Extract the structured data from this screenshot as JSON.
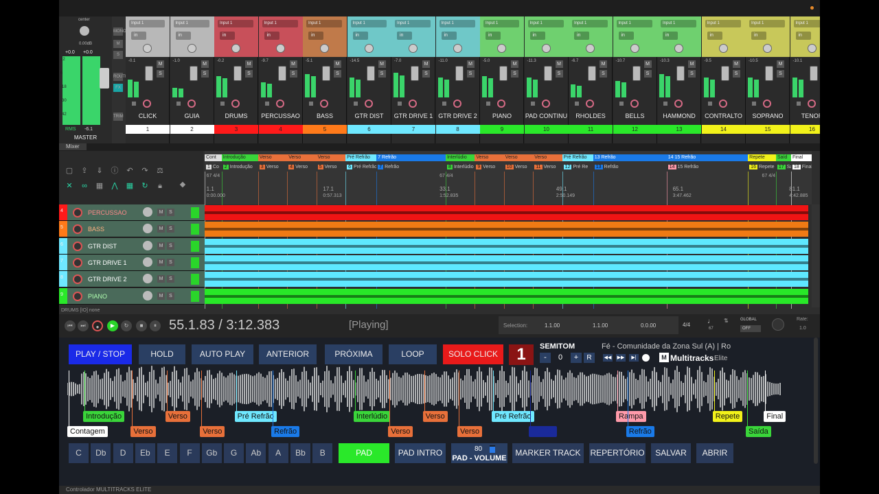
{
  "mixer": {
    "tab": "Mixer",
    "master": {
      "pan": "center",
      "vol_db": "0.00dB",
      "peak_l": "+0.0",
      "peak_r": "+0.0",
      "rms_label": "RMS",
      "rms_value": "-6.1",
      "name": "MASTER",
      "scale": [
        "12",
        "6",
        "-18",
        "-30",
        "-42"
      ],
      "side_buttons": [
        "MONO",
        "M",
        "S",
        "ROUTE",
        "FX",
        "TRIM"
      ],
      "side_button_colors": [
        "#555",
        "#555",
        "#555",
        "#555",
        "#1aa5a5",
        "#555"
      ]
    },
    "strips": [
      {
        "name": "CLICK",
        "num": "1",
        "color": "#b8b8b8",
        "numcolor": "#ffffff",
        "vol": "-0.1",
        "in": "in",
        "input": "Input 1",
        "meter": 0.55
      },
      {
        "name": "GUIA",
        "num": "2",
        "color": "#b8b8b8",
        "numcolor": "#ffffff",
        "vol": "-1.0",
        "in": "in",
        "input": "Input 1",
        "meter": 0.3
      },
      {
        "name": "DRUMS",
        "num": "3",
        "color": "#c8505a",
        "numcolor": "#ff1a1a",
        "vol": "-0.2",
        "in": "in",
        "input": "Input 1",
        "meter": 0.65
      },
      {
        "name": "PERCUSSAO",
        "num": "4",
        "color": "#c8505a",
        "numcolor": "#ff1a1a",
        "vol": "-9.7",
        "in": "in",
        "input": "Input 1",
        "meter": 0.45
      },
      {
        "name": "BASS",
        "num": "5",
        "color": "#c07a4a",
        "numcolor": "#ff7a1a",
        "vol": "-5.1",
        "in": "in",
        "input": "Input 1",
        "meter": 0.7
      },
      {
        "name": "GTR DIST",
        "num": "6",
        "color": "#6fc8c8",
        "numcolor": "#6fe8ff",
        "vol": "-14.5",
        "in": "in",
        "input": "Input 1",
        "meter": 0.6
      },
      {
        "name": "GTR DRIVE 1",
        "num": "7",
        "color": "#6fc8c8",
        "numcolor": "#6fe8ff",
        "vol": "-7.0",
        "in": "in",
        "input": "Input 1",
        "meter": 0.75
      },
      {
        "name": "GTR DRIVE 2",
        "num": "8",
        "color": "#6fc8c8",
        "numcolor": "#6fe8ff",
        "vol": "-11.0",
        "in": "in",
        "input": "Input 1",
        "meter": 0.6
      },
      {
        "name": "PIANO",
        "num": "9",
        "color": "#6fd06f",
        "numcolor": "#2ae82a",
        "vol": "-5.0",
        "in": "in",
        "input": "Input 1",
        "meter": 0.65
      },
      {
        "name": "PAD CONTINU",
        "num": "10",
        "color": "#6fd06f",
        "numcolor": "#2ae82a",
        "vol": "-11.3",
        "in": "in",
        "input": "Input 1",
        "meter": 0.6
      },
      {
        "name": "RHOLDES",
        "num": "11",
        "color": "#6fd06f",
        "numcolor": "#2ae82a",
        "vol": "-6.7",
        "in": "in",
        "input": "Input 1",
        "meter": 0.4
      },
      {
        "name": "BELLS",
        "num": "12",
        "color": "#6fd06f",
        "numcolor": "#2ae82a",
        "vol": "-10.7",
        "in": "in",
        "input": "Input 1",
        "meter": 0.5
      },
      {
        "name": "HAMMOND",
        "num": "13",
        "color": "#6fd06f",
        "numcolor": "#2ae82a",
        "vol": "-10.3",
        "in": "in",
        "input": "Input 1",
        "meter": 0.7
      },
      {
        "name": "CONTRALTO",
        "num": "14",
        "color": "#c8c85a",
        "numcolor": "#f2f21a",
        "vol": "-9.5",
        "in": "in",
        "input": "Input 1",
        "meter": 0.6
      },
      {
        "name": "SOPRANO",
        "num": "15",
        "color": "#c8c85a",
        "numcolor": "#f2f21a",
        "vol": "-10.5",
        "in": "in",
        "input": "Input 1",
        "meter": 0.6
      },
      {
        "name": "TENOR",
        "num": "16",
        "color": "#c8c85a",
        "numcolor": "#f2f21a",
        "vol": "-10.1",
        "in": "in",
        "input": "Input 1",
        "meter": 0.6
      }
    ]
  },
  "arrange": {
    "regions": [
      {
        "label": "Cont",
        "color": "#dddddd"
      },
      {
        "label": "Introdução",
        "color": "#3ad53a"
      },
      {
        "label": "Verso",
        "color": "#e8703a"
      },
      {
        "label": "Verso",
        "color": "#e8703a"
      },
      {
        "label": "Verso",
        "color": "#e8703a"
      },
      {
        "label": "Pré Refrão",
        "color": "#6fe8ff"
      },
      {
        "label": "7  Refrão",
        "color": "#1a7ae8"
      },
      {
        "label": "Interlúdio",
        "color": "#3ad53a"
      },
      {
        "label": "Verso",
        "color": "#e8703a"
      },
      {
        "label": "Verso",
        "color": "#e8703a"
      },
      {
        "label": "Verso",
        "color": "#e8703a"
      },
      {
        "label": "Pré Refrão",
        "color": "#6fe8ff"
      },
      {
        "label": "13  Refrão",
        "color": "#1a7ae8"
      },
      {
        "label": "14  15  Refrão",
        "color": "#1a7ae8"
      },
      {
        "label": "Repete",
        "color": "#f2f21a"
      },
      {
        "label": "Saíd",
        "color": "#3ad53a"
      },
      {
        "label": "Final",
        "color": "#ffffff"
      }
    ],
    "region_pos": [
      0,
      0.028,
      0.088,
      0.136,
      0.184,
      0.232,
      0.283,
      0.397,
      0.445,
      0.493,
      0.541,
      0.589,
      0.64,
      0.761,
      0.895,
      0.941,
      0.966
    ],
    "markers": [
      {
        "num": "1",
        "label": "Co",
        "color": "#dddddd"
      },
      {
        "num": "2",
        "label": "Introdução",
        "color": "#3ad53a"
      },
      {
        "num": "3",
        "label": "Verso",
        "color": "#e8703a"
      },
      {
        "num": "4",
        "label": "Verso",
        "color": "#e8703a"
      },
      {
        "num": "5",
        "label": "Verso",
        "color": "#e8703a"
      },
      {
        "num": "6",
        "label": "Pré Refrão",
        "color": "#6fe8ff"
      },
      {
        "num": "7",
        "label": "Refrão",
        "color": "#1a7ae8"
      },
      {
        "num": "8",
        "label": "Interlúdio",
        "color": "#3ad53a"
      },
      {
        "num": "9",
        "label": "Verso",
        "color": "#e8703a"
      },
      {
        "num": "10",
        "label": "Verso",
        "color": "#e8703a"
      },
      {
        "num": "11",
        "label": "Verso",
        "color": "#e8703a"
      },
      {
        "num": "12",
        "label": "Pré Re",
        "color": "#6fe8ff"
      },
      {
        "num": "13",
        "label": "Refrão",
        "color": "#1a7ae8"
      },
      {
        "num": "14",
        "label": "15 Refrão",
        "color": "#ff9aaa"
      },
      {
        "num": "16",
        "label": "Repete",
        "color": "#f2f21a"
      },
      {
        "num": "17",
        "label": "Saída",
        "color": "#3ad53a"
      },
      {
        "num": "18",
        "label": "Final",
        "color": "#ffffff"
      }
    ],
    "ticks": [
      {
        "bar": "1.1",
        "time": "0:00.000",
        "pos": 0.003
      },
      {
        "bar": "17.1",
        "time": "0:57.313",
        "pos": 0.195
      },
      {
        "bar": "33.1",
        "time": "1:52.835",
        "pos": 0.387
      },
      {
        "bar": "49.1",
        "time": "2:50.149",
        "pos": 0.579
      },
      {
        "bar": "65.1",
        "time": "3:47.462",
        "pos": 0.771
      },
      {
        "bar": "81.1",
        "time": "4:42.885",
        "pos": 0.963
      }
    ],
    "tempo_marks": [
      {
        "label": "67 4/4",
        "pos": 0.003
      },
      {
        "label": "67 4/4",
        "pos": 0.387
      },
      {
        "label": "67 4/4",
        "pos": 0.918
      }
    ],
    "tracks": [
      {
        "num": "4",
        "name": "PERCUSSAO",
        "color": "#ff1a1a",
        "lane": "#f01414",
        "text": "#ff8a8a"
      },
      {
        "num": "5",
        "name": "BASS",
        "color": "#ff7a1a",
        "lane": "#f07a14",
        "text": "#ffb080"
      },
      {
        "num": "6",
        "name": "GTR DIST",
        "color": "#6fe8ff",
        "lane": "#5ee8ff",
        "text": "#ffffff"
      },
      {
        "num": "7",
        "name": "GTR DRIVE 1",
        "color": "#6fe8ff",
        "lane": "#5ee8ff",
        "text": "#ffffff"
      },
      {
        "num": "8",
        "name": "GTR DRIVE 2",
        "color": "#6fe8ff",
        "lane": "#5ee8ff",
        "text": "#ffffff"
      },
      {
        "num": "9",
        "name": "PIANO",
        "color": "#2ae82a",
        "lane": "#28e828",
        "text": "#b0ffb0"
      }
    ],
    "status": "DRUMS [IO] none"
  },
  "transport": {
    "time": "55.1.83 / 3:12.383",
    "state": "[Playing]",
    "selection_label": "Selection:",
    "sel_start": "1.1.00",
    "sel_end": "1.1.00",
    "sel_len": "0.0.00",
    "signature": "4/4",
    "tempo": "67",
    "global": "GLOBAL",
    "global_state": "OFF",
    "rate_label": "Rate:",
    "rate": "1.0"
  },
  "controller": {
    "buttons": [
      {
        "label": "PLAY / STOP",
        "bg": "#1a2ae8"
      },
      {
        "label": "HOLD",
        "bg": "#2a3f63"
      },
      {
        "label": "AUTO PLAY",
        "bg": "#2a3f63"
      },
      {
        "label": "ANTERIOR",
        "bg": "#2a3f63"
      },
      {
        "label": "PRÓXIMA",
        "bg": "#2a3f63"
      },
      {
        "label": "LOOP",
        "bg": "#2a3f63"
      },
      {
        "label": "SOLO CLICK",
        "bg": "#e81a1a"
      }
    ],
    "big_number": "1",
    "semitom_label": "SEMITOM",
    "semitom_value": "0",
    "semitom_minus": "-",
    "semitom_plus": "+",
    "semitom_reset": "R",
    "song_title": "Fé - Comunidade da Zona Sul (A)  |  Ro",
    "brand": "Multitracks",
    "brand_suffix": "Elite",
    "labels": [
      {
        "text": "Contagem",
        "bg": "#ffffff",
        "fg": "#111",
        "x": 0.0,
        "row": 1
      },
      {
        "text": "Introdução",
        "bg": "#3ad53a",
        "fg": "#111",
        "x": 0.022,
        "row": 0
      },
      {
        "text": "Verso",
        "bg": "#e8703a",
        "fg": "#111",
        "x": 0.088,
        "row": 1
      },
      {
        "text": "Verso",
        "bg": "#e8703a",
        "fg": "#111",
        "x": 0.136,
        "row": 0
      },
      {
        "text": "Verso",
        "bg": "#e8703a",
        "fg": "#111",
        "x": 0.184,
        "row": 1
      },
      {
        "text": "Pré Refrão",
        "bg": "#6fe8ff",
        "fg": "#111",
        "x": 0.232,
        "row": 0
      },
      {
        "text": "Refrão",
        "bg": "#1a7ae8",
        "fg": "#111",
        "x": 0.283,
        "row": 1
      },
      {
        "text": "Interlúdio",
        "bg": "#3ad53a",
        "fg": "#111",
        "x": 0.397,
        "row": 0
      },
      {
        "text": "Verso",
        "bg": "#e8703a",
        "fg": "#111",
        "x": 0.445,
        "row": 1
      },
      {
        "text": "Verso",
        "bg": "#e8703a",
        "fg": "#111",
        "x": 0.493,
        "row": 0
      },
      {
        "text": "Verso",
        "bg": "#e8703a",
        "fg": "#111",
        "x": 0.541,
        "row": 1
      },
      {
        "text": "Pré Refrão",
        "bg": "#6fe8ff",
        "fg": "#111",
        "x": 0.589,
        "row": 0
      },
      {
        "text": "Refrão",
        "bg": "#1a2a9a",
        "fg": "#1a2a9a",
        "x": 0.64,
        "row": 1
      },
      {
        "text": "Rampa",
        "bg": "#ff9aaa",
        "fg": "#111",
        "x": 0.761,
        "row": 0
      },
      {
        "text": "Refrão",
        "bg": "#1a7ae8",
        "fg": "#111",
        "x": 0.775,
        "row": 1
      },
      {
        "text": "Repete",
        "bg": "#f2f21a",
        "fg": "#111",
        "x": 0.895,
        "row": 0
      },
      {
        "text": "Saída",
        "bg": "#3ad53a",
        "fg": "#111",
        "x": 0.941,
        "row": 1
      },
      {
        "text": "Final",
        "bg": "#ffffff",
        "fg": "#111",
        "x": 0.966,
        "row": 0
      }
    ],
    "keys": [
      "C",
      "Db",
      "D",
      "Eb",
      "E",
      "F",
      "Gb",
      "G",
      "Ab",
      "A",
      "Bb",
      "B"
    ],
    "pad": "PAD",
    "pad_intro": "PAD INTRO",
    "pad_volume_value": "80",
    "pad_volume_label": "PAD - VOLUME",
    "pad_volume_level": 0.8,
    "bottom_buttons": [
      "MARKER TRACK",
      "REPERTÓRIO",
      "SALVAR",
      "ABRIR"
    ],
    "footer": "Controlador MULTITRACKS ELITE"
  }
}
